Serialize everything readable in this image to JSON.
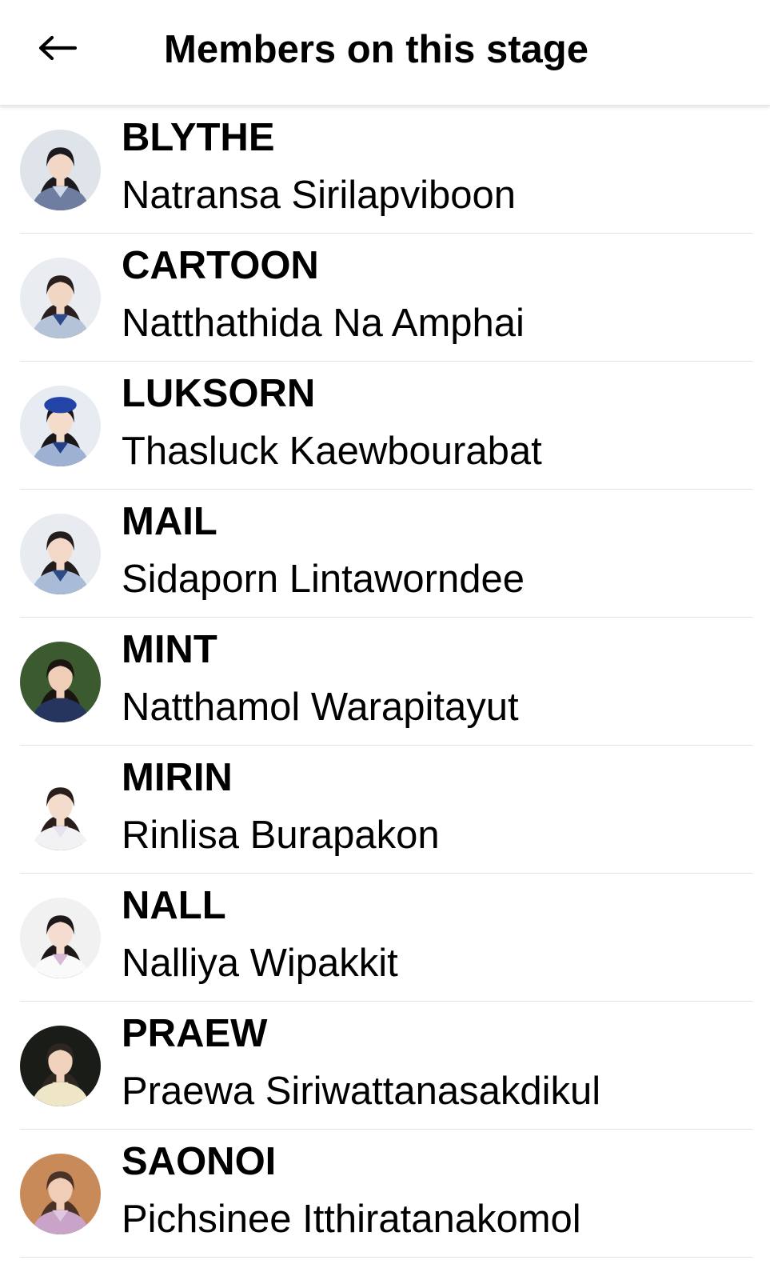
{
  "header": {
    "title": "Members on this stage",
    "back_icon": "arrow-left-icon"
  },
  "members": [
    {
      "nickname": "BLYTHE",
      "full_name": "Natransa Sirilapviboon",
      "bg": "#dfe4ea",
      "hair": "#1c1a1e",
      "face": "#f3d7c6",
      "top": "#6f7ea0",
      "collar": "#cfd8e8"
    },
    {
      "nickname": "CARTOON",
      "full_name": "Natthathida Na Amphai",
      "bg": "#e9ecf1",
      "hair": "#2a1f1c",
      "face": "#f2d6c4",
      "top": "#b5c3d8",
      "collar": "#2e4a8a"
    },
    {
      "nickname": "LUKSORN",
      "full_name": "Thasluck Kaewbourabat",
      "bg": "#e7ebf2",
      "hair": "#1a1718",
      "face": "#f4dccb",
      "top": "#9db2d2",
      "collar": "#233f86",
      "hat": "#2244a6"
    },
    {
      "nickname": "MAIL",
      "full_name": "Sidaporn Lintaworndee",
      "bg": "#e8ebf0",
      "hair": "#221c1c",
      "face": "#f3d8c8",
      "top": "#a8bcd8",
      "collar": "#2d4a86"
    },
    {
      "nickname": "MINT",
      "full_name": "Natthamol Warapitayut",
      "bg": "#3c5a2f",
      "hair": "#1b1512",
      "face": "#efcdb7",
      "top": "#26355e",
      "collar": "#26355e"
    },
    {
      "nickname": "MIRIN",
      "full_name": "Rinlisa Burapakon",
      "bg": "#ffffff",
      "hair": "#2a1e1a",
      "face": "#f4dccd",
      "top": "#f2f2f5",
      "collar": "#e8e1f0"
    },
    {
      "nickname": "NALL",
      "full_name": "Nalliya Wipakkit",
      "bg": "#f1f1f1",
      "hair": "#1e1818",
      "face": "#f4ddd0",
      "top": "#fafafa",
      "collar": "#d9b8d8"
    },
    {
      "nickname": "PRAEW",
      "full_name": "Praewa Siriwattanasakdikul",
      "bg": "#1a1c18",
      "hair": "#2e2620",
      "face": "#f0d2bd",
      "top": "#efe6c8",
      "collar": "#efe6c8"
    },
    {
      "nickname": "SAONOI",
      "full_name": "Pichsinee Itthiratanakomol",
      "bg": "#c98a5a",
      "hair": "#4a3326",
      "face": "#f0cdb6",
      "top": "#c9a4c8",
      "collar": "#e0c7e0"
    }
  ]
}
